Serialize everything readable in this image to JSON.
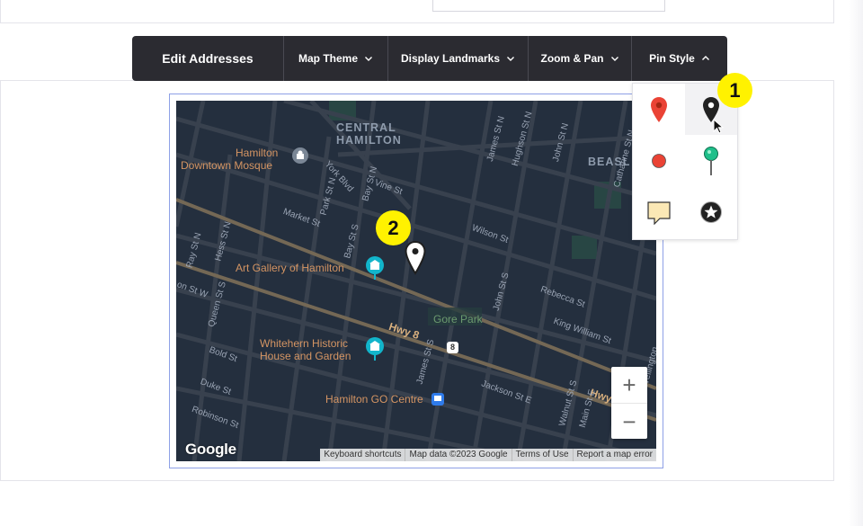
{
  "toolbar": {
    "title": "Edit Addresses",
    "buttons": [
      "Map Theme",
      "Display Landmarks",
      "Zoom & Pan",
      "Pin Style"
    ]
  },
  "map": {
    "district_labels": [
      "CENTRAL",
      "HAMILTON",
      "BEASL"
    ],
    "poi": [
      "Hamilton",
      "Downtown Mosque",
      "Art Gallery of Hamilton",
      "Whitehern Historic",
      "House and Garden",
      "Hamilton GO Centre"
    ],
    "park": "Gore Park",
    "highway": [
      "Hwy 8",
      "Hwy"
    ],
    "route_shield": "8",
    "streets": [
      "York Blvd",
      "Bay St N",
      "Vine St",
      "Market St",
      "Bay St S",
      "Park St N",
      "Wilson St",
      "James St N",
      "Hughson St N",
      "John St N",
      "Ray St N",
      "Hess St N",
      "on St W",
      "Queen St S",
      "John St S",
      "Rebecca St",
      "King William St",
      "Catharine St N",
      "Bold St",
      "Duke St",
      "Robinson St",
      "Jackson St E",
      "Walnut St S",
      "Main St E",
      "James St S",
      "Wellington"
    ],
    "zoom_in": "+",
    "zoom_out": "−",
    "logo": "Google",
    "attribution": [
      "Keyboard shortcuts",
      "Map data ©2023 Google",
      "Terms of Use",
      "Report a map error"
    ]
  },
  "pin_style": {
    "options": [
      "red-marker-icon",
      "black-marker-icon",
      "red-dot-icon",
      "green-pushpin-icon",
      "note-icon",
      "star-circle-icon"
    ],
    "selected": "black-marker-icon"
  },
  "callouts": [
    "1",
    "2"
  ],
  "colors": {
    "toolbar_bg": "#2b2b31",
    "map_bg": "#242f3e",
    "road": "#38414e",
    "highway": "#746855",
    "label": "#d59563",
    "callout": "#fff200"
  }
}
